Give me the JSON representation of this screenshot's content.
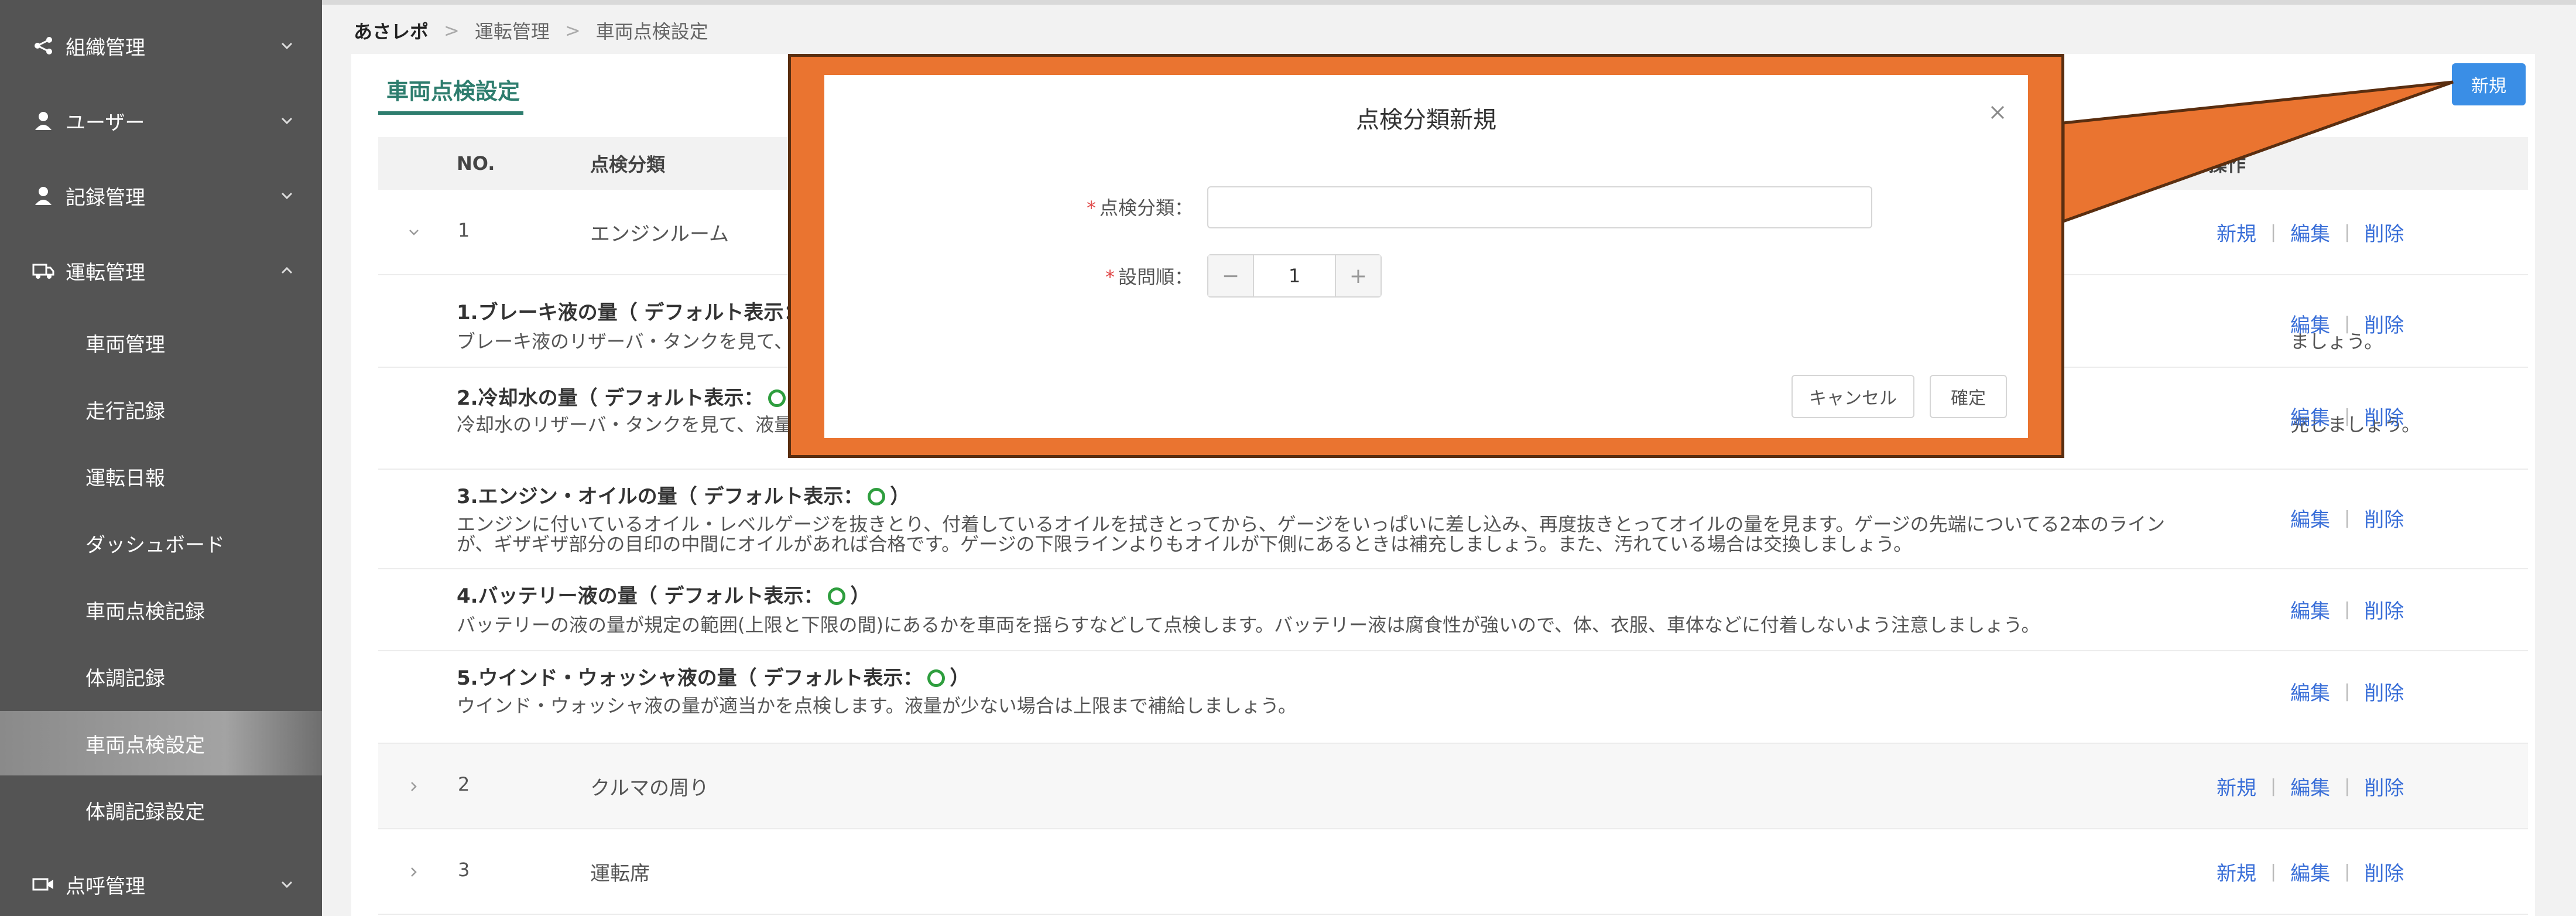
{
  "sidebar": {
    "groups": [
      {
        "label": "組織管理",
        "icon": "share-icon"
      },
      {
        "label": "ユーザー",
        "icon": "user-icon"
      },
      {
        "label": "記録管理",
        "icon": "user-icon"
      },
      {
        "label": "運転管理",
        "icon": "truck-icon"
      },
      {
        "label": "点呼管理",
        "icon": "video-icon"
      }
    ],
    "items": [
      {
        "label": "車両管理"
      },
      {
        "label": "走行記録"
      },
      {
        "label": "運転日報"
      },
      {
        "label": "ダッシュボード"
      },
      {
        "label": "車両点検記録"
      },
      {
        "label": "体調記録"
      },
      {
        "label": "車両点検設定"
      },
      {
        "label": "体調記録設定"
      }
    ]
  },
  "breadcrumb": {
    "home": "あさレポ",
    "level1": "運転管理",
    "level2": "車両点検設定"
  },
  "page": {
    "tab": "車両点検設定",
    "new_button": "新規"
  },
  "table": {
    "headers": {
      "no": "NO.",
      "category": "点検分類",
      "ops": "操作"
    },
    "actions": {
      "new": "新規",
      "edit": "編集",
      "delete": "削除",
      "sep": "|"
    },
    "rows": [
      {
        "no": "1",
        "category": "エンジンルーム",
        "expanded": true
      },
      {
        "no": "2",
        "category": "クルマの周り",
        "expanded": false
      },
      {
        "no": "3",
        "category": "運転席",
        "expanded": false
      }
    ],
    "children": [
      {
        "title_prefix": "1.ブレーキ液の量（ デフォルト表示：",
        "title_suffix": "",
        "desc": "ブレーキ液のリザーバ・タンクを見て、",
        "desc_tail": "ましょう。"
      },
      {
        "title_prefix": "2.冷却水の量（ デフォルト表示：",
        "title_suffix": "）",
        "desc": "冷却水のリザーバ・タンクを見て、液量",
        "desc_tail": "充しましょう。"
      },
      {
        "title_prefix": "3.エンジン・オイルの量（ デフォルト表示：",
        "title_suffix": "）",
        "desc": "エンジンに付いているオイル・レベルゲージを抜きとり、付着しているオイルを拭きとってから、ゲージをいっぱいに差し込み、再度抜きとってオイルの量を見ます。ゲージの先端についてる2本のラインが、ギザギザ部分の目印の中間にオイルがあれば合格です。ゲージの下限ラインよりもオイルが下側にあるときは補充しましょう。また、汚れている場合は交換しましょう。"
      },
      {
        "title_prefix": "4.バッテリー液の量（ デフォルト表示：",
        "title_suffix": "）",
        "desc": "バッテリーの液の量が規定の範囲(上限と下限の間)にあるかを車両を揺らすなどして点検します。バッテリー液は腐食性が強いので、体、衣服、車体などに付着しないよう注意しましょう。"
      },
      {
        "title_prefix": "5.ウインド・ウォッシャ液の量（ デフォルト表示：",
        "title_suffix": "）",
        "desc": "ウインド・ウォッシャ液の量が適当かを点検します。液量が少ない場合は上限まで補給しましょう。"
      }
    ]
  },
  "modal": {
    "title": "点検分類新規",
    "category_label": "点検分類：",
    "category_value": "",
    "order_label": "設問順：",
    "order_value": "1",
    "minus": "−",
    "plus": "+",
    "required_mark": "*",
    "cancel": "キャンセル",
    "ok": "確定"
  },
  "colors": {
    "sidebar_bg": "#545454",
    "accent": "#2e7d6e",
    "link": "#3a6fd8",
    "primary_button": "#3a8ee6",
    "highlight": "#ea7430",
    "required": "#e04a4a",
    "ok_mark": "#2e9e3e"
  }
}
